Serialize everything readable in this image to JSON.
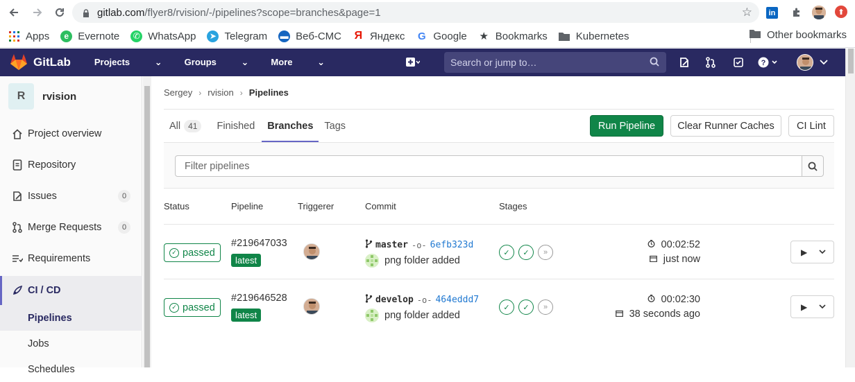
{
  "browser": {
    "url_host": "gitlab.com",
    "url_rest": "/flyer8/rvision/-/pipelines?scope=branches&page=1",
    "bookmarks": [
      {
        "label": "Apps",
        "icon": "apps-grid-icon"
      },
      {
        "label": "Evernote",
        "icon": "evernote-icon"
      },
      {
        "label": "WhatsApp",
        "icon": "whatsapp-icon"
      },
      {
        "label": "Telegram",
        "icon": "telegram-icon"
      },
      {
        "label": "Веб-СМС",
        "icon": "sms-icon"
      },
      {
        "label": "Яндекс",
        "icon": "yandex-icon"
      },
      {
        "label": "Google",
        "icon": "google-icon"
      },
      {
        "label": "Bookmarks",
        "icon": "star-icon"
      },
      {
        "label": "Kubernetes",
        "icon": "folder-icon"
      }
    ],
    "other_bookmarks": "Other bookmarks"
  },
  "header": {
    "brand": "GitLab",
    "menu": [
      "Projects",
      "Groups",
      "More"
    ],
    "search_placeholder": "Search or jump to…"
  },
  "sidebar": {
    "project_initial": "R",
    "project_name": "rvision",
    "items": [
      {
        "label": "Project overview",
        "icon": "home-icon"
      },
      {
        "label": "Repository",
        "icon": "doc-icon"
      },
      {
        "label": "Issues",
        "icon": "issues-icon",
        "count": "0"
      },
      {
        "label": "Merge Requests",
        "icon": "merge-request-icon",
        "count": "0"
      },
      {
        "label": "Requirements",
        "icon": "requirements-icon"
      },
      {
        "label": "CI / CD",
        "icon": "rocket-icon"
      }
    ],
    "sub_items": [
      "Pipelines",
      "Jobs",
      "Schedules"
    ]
  },
  "breadcrumb": [
    "Sergey",
    "rvision",
    "Pipelines"
  ],
  "tabs": [
    {
      "label": "All",
      "badge": "41"
    },
    {
      "label": "Finished"
    },
    {
      "label": "Branches"
    },
    {
      "label": "Tags"
    }
  ],
  "actions": {
    "run_pipeline": "Run Pipeline",
    "clear_caches": "Clear Runner Caches",
    "ci_lint": "CI Lint"
  },
  "filter": {
    "placeholder": "Filter pipelines"
  },
  "table": {
    "columns": [
      "Status",
      "Pipeline",
      "Triggerer",
      "Commit",
      "Stages"
    ],
    "rows": [
      {
        "status": "passed",
        "pipeline_id": "#219647033",
        "tag": "latest",
        "branch": "master",
        "sha": "6efb323d",
        "message": "png folder added",
        "duration": "00:02:52",
        "finished": "just now"
      },
      {
        "status": "passed",
        "pipeline_id": "#219646528",
        "tag": "latest",
        "branch": "develop",
        "sha": "464eddd7",
        "message": "png folder added",
        "duration": "00:02:30",
        "finished": "38 seconds ago"
      }
    ]
  },
  "colors": {
    "header_bg": "#292961",
    "success": "#108548",
    "link": "#1f78d1",
    "tab_active": "#6666c4"
  }
}
